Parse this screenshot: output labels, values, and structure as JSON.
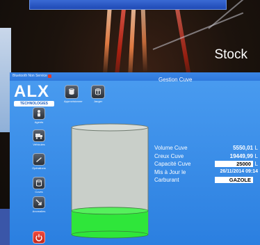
{
  "background": {
    "stock_label": "Stock"
  },
  "window": {
    "title_left": "Bluetooth Non Service",
    "title": "Gestion Cuve"
  },
  "logo": {
    "brand": "ALX",
    "sub": "TECHNOLOGIES"
  },
  "toolbar": {
    "approvisionner": "Approvisionner",
    "jauger": "Jauger"
  },
  "sidebar": {
    "items": [
      {
        "label": "Agents",
        "icon": "agent-icon"
      },
      {
        "label": "Véhicules",
        "icon": "truck-icon"
      },
      {
        "label": "Opérations",
        "icon": "fuel-pump-icon"
      },
      {
        "label": "Cuves",
        "icon": "tank-icon"
      },
      {
        "label": "Anomalies",
        "icon": "report-icon"
      },
      {
        "label": "",
        "icon": "power-icon"
      }
    ]
  },
  "tank": {
    "fill_fraction": 0.222,
    "level_color": "#2fe63a",
    "body_color": "#c9cfc9"
  },
  "info": {
    "volume_label": "Volume Cuve",
    "volume_value": "5550,01",
    "volume_unit": "L",
    "creux_label": "Creux Cuve",
    "creux_value": "19449,99",
    "creux_unit": "L",
    "capacite_label": "Capacité Cuve",
    "capacite_value": "25000",
    "capacite_unit": "L",
    "maj_label": "Mis à Jour le",
    "maj_value": "26/11/2014 09:14",
    "carburant_label": "Carburant",
    "carburant_value": "GAZOLE"
  }
}
